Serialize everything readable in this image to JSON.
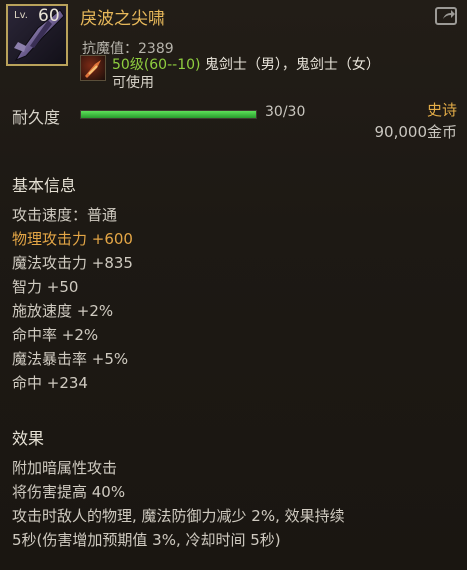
{
  "header": {
    "lv_label": "Lv.",
    "level": "60",
    "title": "戾波之尖啸",
    "resist": "抗魔值：2389",
    "requirement_level": "50级(60--10)",
    "requirement_class": " 鬼剑士（男），鬼剑士（女）",
    "usable": "可使用"
  },
  "durability": {
    "label": "耐久度",
    "value": "30/30",
    "ratio": 1.0
  },
  "rarity": "史诗",
  "price": "90,000金币",
  "basic": {
    "title": "基本信息",
    "lines": [
      "攻击速度：普通",
      "物理攻击力 +600",
      "魔法攻击力 +835",
      "智力 +50",
      "施放速度 +2%",
      "命中率 +2%",
      "魔法暴击率 +5%",
      "命中 +234"
    ]
  },
  "effect": {
    "title": "效果",
    "lines": [
      "附加暗属性攻击",
      "将伤害提高 40%",
      "攻击时敌人的物理, 魔法防御力减少 2%, 效果持续",
      "5秒(伤害增加预期值 3%, 冷却时间 5秒)"
    ]
  },
  "colors": {
    "title": "#e7b85a",
    "rarity": "#e4ad48",
    "highlight": "#e4a646",
    "level_green": "#8fce3f"
  }
}
